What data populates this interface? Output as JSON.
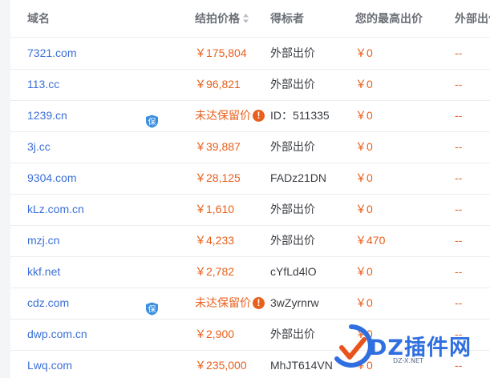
{
  "colors": {
    "accent": "#3b6fd8",
    "price": "#e8601c",
    "text": "#3a3d42",
    "header": "#6b6f76"
  },
  "header": {
    "domain": "域名",
    "price": "结拍价格",
    "winner": "得标者",
    "my_bid": "您的最高出价",
    "external": "外部出价"
  },
  "rows": [
    {
      "domain": "7321.com",
      "price": "￥175,804",
      "winner": "外部出价",
      "my_bid": "￥0",
      "external": "--",
      "badge": false
    },
    {
      "domain": "113.cc",
      "price": "￥96,821",
      "winner": "外部出价",
      "my_bid": "￥0",
      "external": "--",
      "badge": false
    },
    {
      "domain": "1239.cn",
      "price": "未达保留价",
      "winner": "ID：511335",
      "my_bid": "￥0",
      "external": "--",
      "badge": true,
      "warn": true
    },
    {
      "domain": "3j.cc",
      "price": "￥39,887",
      "winner": "外部出价",
      "my_bid": "￥0",
      "external": "--",
      "badge": false
    },
    {
      "domain": "9304.com",
      "price": "￥28,125",
      "winner": "FADz21DN",
      "my_bid": "￥0",
      "external": "--",
      "badge": false
    },
    {
      "domain": "kLz.com.cn",
      "price": "￥1,610",
      "winner": "外部出价",
      "my_bid": "￥0",
      "external": "--",
      "badge": false
    },
    {
      "domain": "mzj.cn",
      "price": "￥4,233",
      "winner": "外部出价",
      "my_bid": "￥470",
      "external": "--",
      "badge": false
    },
    {
      "domain": "kkf.net",
      "price": "￥2,782",
      "winner": "cYfLd4lO",
      "my_bid": "￥0",
      "external": "--",
      "badge": false
    },
    {
      "domain": "cdz.com",
      "price": "未达保留价",
      "winner": "3wZyrnrw",
      "my_bid": "￥0",
      "external": "--",
      "badge": true,
      "warn": true
    },
    {
      "domain": "dwp.com.cn",
      "price": "￥2,900",
      "winner": "外部出价",
      "my_bid": "￥0",
      "external": "--",
      "badge": false
    },
    {
      "domain": "Lwq.com",
      "price": "￥235,000",
      "winner": "MhJT614VN",
      "my_bid": "￥0",
      "external": "--",
      "badge": false
    }
  ],
  "icons": {
    "badge": "保",
    "warn": "!",
    "sort": "sort-icon"
  },
  "watermark": {
    "main": "DZ插件网",
    "sub": "DZ-X.NET"
  }
}
